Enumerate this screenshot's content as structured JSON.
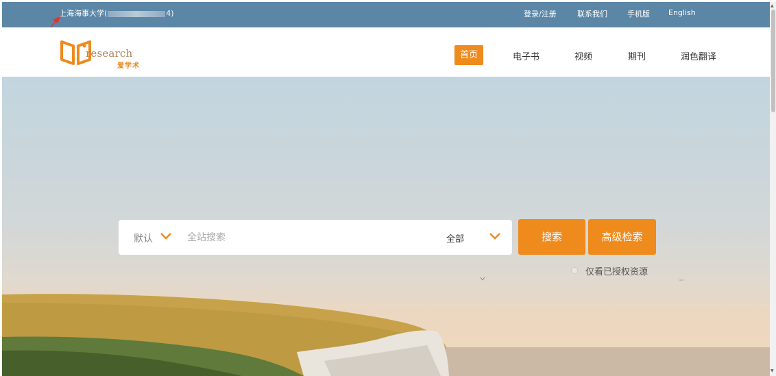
{
  "topbar": {
    "institution_prefix": "上海海事大学(",
    "institution_suffix": "4)",
    "links": [
      "登录/注册",
      "联系我们",
      "手机版",
      "English"
    ]
  },
  "logo": {
    "word": "research",
    "cn": "爱学术"
  },
  "nav": {
    "items": [
      "首页",
      "电子书",
      "视频",
      "期刊",
      "润色翻译"
    ],
    "active_index": 0
  },
  "search": {
    "scope": "默认",
    "placeholder": "全站搜索",
    "category": "全部",
    "search_button": "搜索",
    "advanced_button": "高级检索",
    "authorized_only_label": "仅看已授权资源"
  },
  "colors": {
    "topbar": "#5b86a6",
    "accent": "#ef8a1c"
  },
  "icons": [
    "logo-book-icon",
    "chevron-down-icon",
    "radio-icon",
    "annotation-arrow-icon"
  ]
}
